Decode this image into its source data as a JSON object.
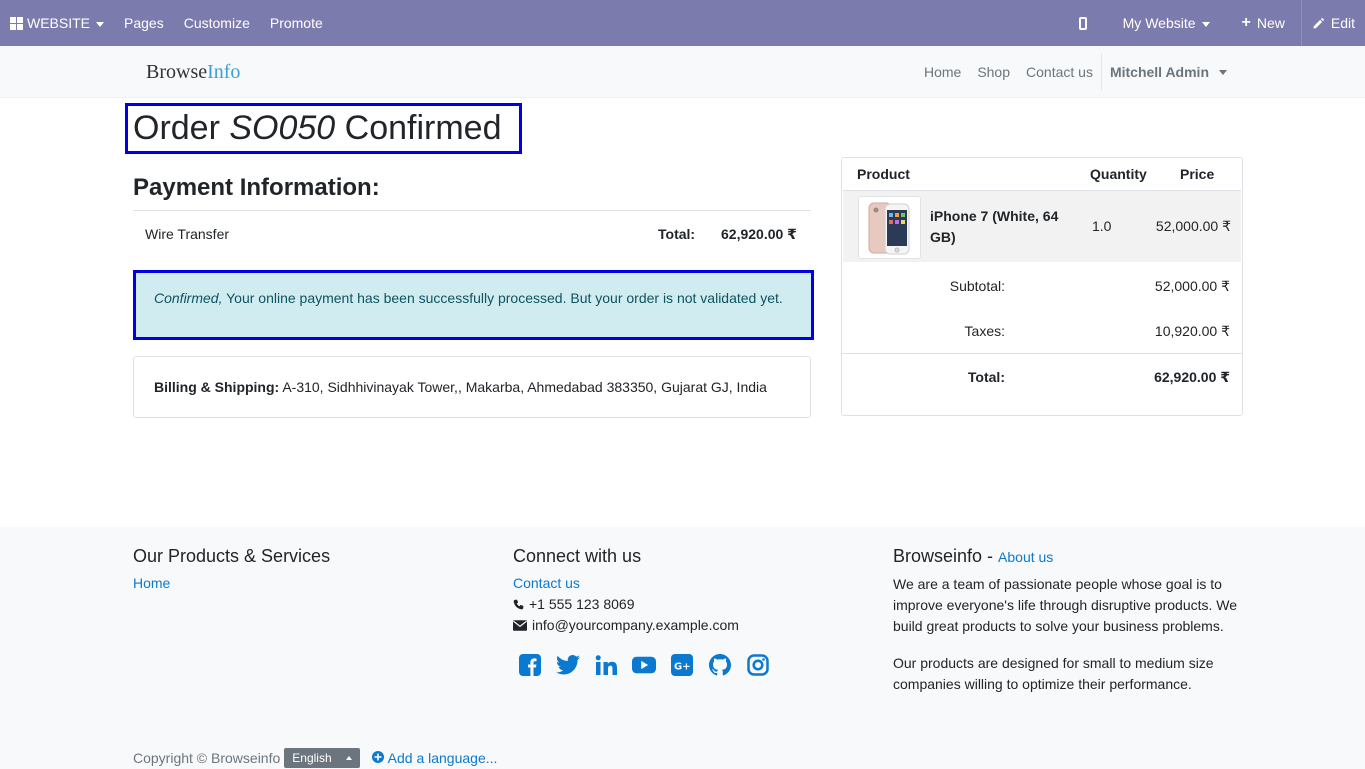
{
  "topbar": {
    "app_label": "WEBSITE",
    "menu": [
      "Pages",
      "Customize",
      "Promote"
    ],
    "site_selector": "My Website",
    "new_label": "New",
    "edit_label": "Edit"
  },
  "header": {
    "logo_part1": "Browse",
    "logo_part2": "Info",
    "nav": [
      "Home",
      "Shop",
      "Contact us"
    ],
    "user": "Mitchell Admin"
  },
  "order": {
    "title_prefix": "Order ",
    "order_number": "SO050",
    "title_suffix": " Confirmed"
  },
  "payment": {
    "heading": "Payment Information:",
    "method": "Wire Transfer",
    "total_label": "Total:",
    "total_value": "62,920.00 ₹",
    "alert_status": "Confirmed,",
    "alert_text": " Your online payment has been successfully processed. But your order is not validated yet."
  },
  "address": {
    "label": "Billing & Shipping:",
    "value": " A-310, Sidhhivinayak Tower,, Makarba, Ahmedabad 383350, Gujarat GJ, India"
  },
  "order_table": {
    "headers": {
      "product": "Product",
      "quantity": "Quantity",
      "price": "Price"
    },
    "line": {
      "name": "iPhone 7 (White, 64 GB)",
      "quantity": "1.0",
      "price": "52,000.00 ₹"
    },
    "subtotal_label": "Subtotal:",
    "subtotal_value": "52,000.00 ₹",
    "taxes_label": "Taxes:",
    "taxes_value": "10,920.00 ₹",
    "total_label": "Total:",
    "total_value": "62,920.00 ₹"
  },
  "footer": {
    "col1_title": "Our Products & Services",
    "col1_link": "Home",
    "col2_title": "Connect with us",
    "col2_link": "Contact us",
    "phone": "+1 555 123 8069",
    "email": "info@yourcompany.example.com",
    "social_icons": [
      "facebook-icon",
      "twitter-icon",
      "linkedin-icon",
      "youtube-icon",
      "google-plus-icon",
      "github-icon",
      "instagram-icon"
    ],
    "col3_title": "Browseinfo",
    "col3_sep": " - ",
    "col3_link": "About us",
    "about_p1": "We are a team of passionate people whose goal is to improve everyone's life through disruptive products. We build great products to solve your business problems.",
    "about_p2": "Our products are designed for small to medium size companies willing to optimize their performance.",
    "copyright": "Copyright © Browseinfo",
    "language": "English",
    "add_language": "Add a language..."
  },
  "colors": {
    "topbar": "#7C7BAD",
    "highlight_border": "#0000E6",
    "alert_bg": "#d1ecf1",
    "link": "#0b79d0"
  }
}
